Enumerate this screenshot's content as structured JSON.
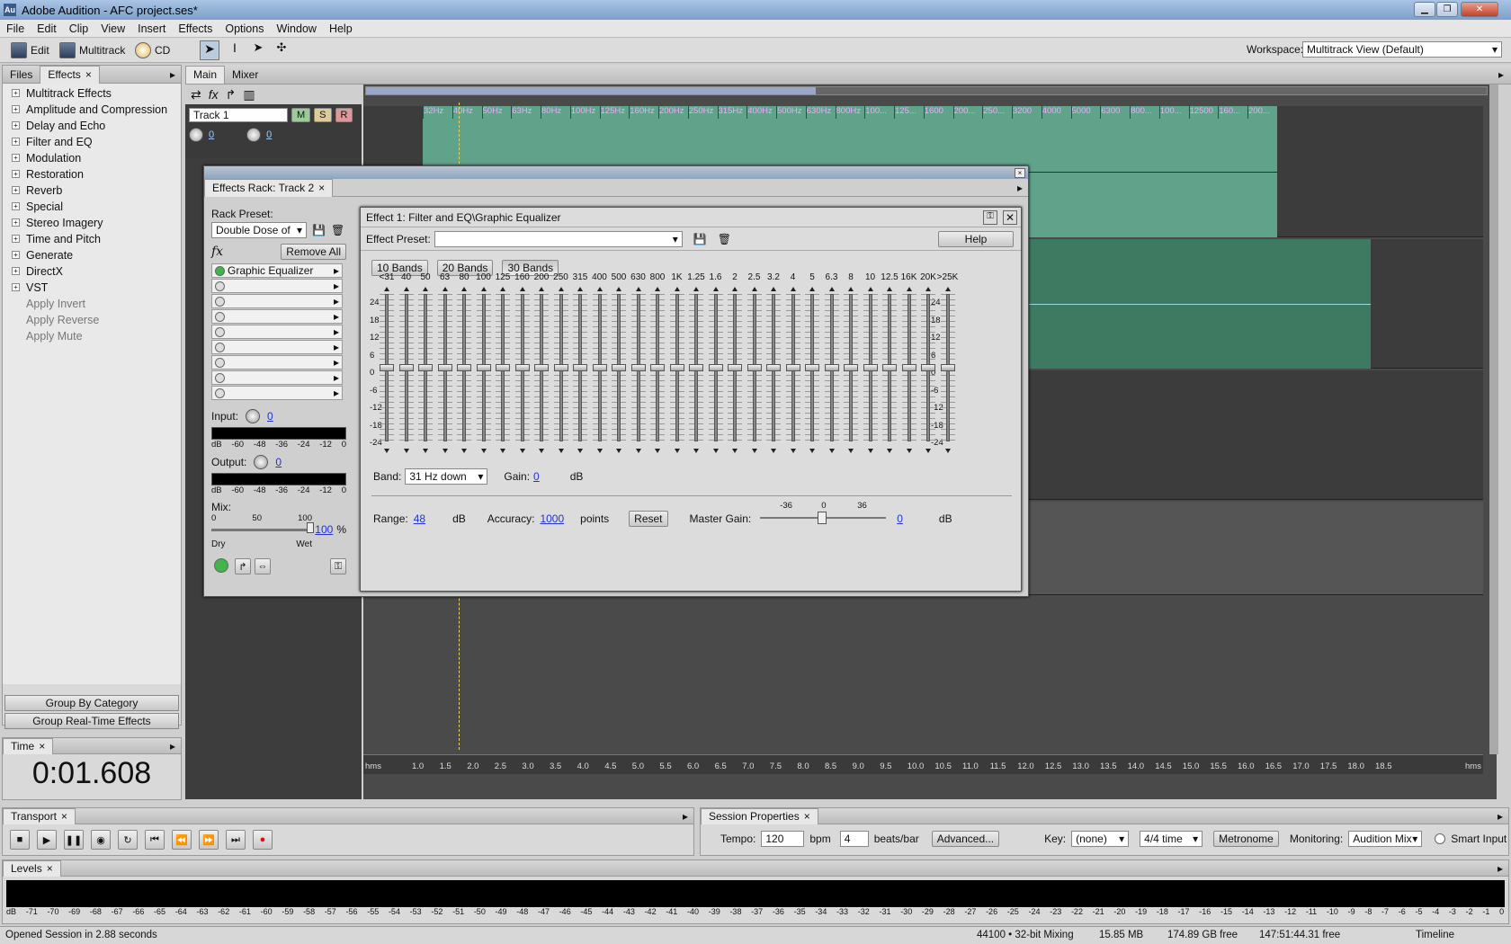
{
  "app": {
    "title": "Adobe Audition - AFC project.ses*",
    "icon": "Au"
  },
  "window_controls": [
    "minimize-icon",
    "restore-icon",
    "close-icon"
  ],
  "menu": [
    "File",
    "Edit",
    "Clip",
    "View",
    "Insert",
    "Effects",
    "Options",
    "Window",
    "Help"
  ],
  "toolbar": {
    "edit": "Edit",
    "multitrack": "Multitrack",
    "cd": "CD",
    "workspace_label": "Workspace:",
    "workspace_value": "Multitrack View (Default)"
  },
  "left_panel": {
    "tabs": [
      "Files",
      "Effects"
    ],
    "tree": [
      {
        "label": "Multitrack Effects",
        "expandable": true
      },
      {
        "label": "Amplitude and Compression",
        "expandable": true
      },
      {
        "label": "Delay and Echo",
        "expandable": true
      },
      {
        "label": "Filter and EQ",
        "expandable": true
      },
      {
        "label": "Modulation",
        "expandable": true
      },
      {
        "label": "Restoration",
        "expandable": true
      },
      {
        "label": "Reverb",
        "expandable": true
      },
      {
        "label": "Special",
        "expandable": true
      },
      {
        "label": "Stereo Imagery",
        "expandable": true
      },
      {
        "label": "Time and Pitch",
        "expandable": true
      },
      {
        "label": "Generate",
        "expandable": true
      },
      {
        "label": "DirectX",
        "expandable": true
      },
      {
        "label": "VST",
        "expandable": true
      },
      {
        "label": "Apply Invert",
        "expandable": false
      },
      {
        "label": "Apply Reverse",
        "expandable": false
      },
      {
        "label": "Apply Mute",
        "expandable": false
      }
    ],
    "group_by_category": "Group By Category",
    "group_realtime": "Group Real-Time Effects"
  },
  "time_panel": {
    "tab": "Time",
    "value": "0:01.608"
  },
  "main_tabs": [
    "Main",
    "Mixer"
  ],
  "track1": {
    "name": "Track 1",
    "m": "M",
    "s": "S",
    "r": "R",
    "vol": "0",
    "pan": "0"
  },
  "spectrum_labels": [
    "32Hz",
    "40Hz",
    "50Hz",
    "63Hz",
    "80Hz",
    "100Hz",
    "125Hz",
    "160Hz",
    "200Hz",
    "250Hz",
    "315Hz",
    "400Hz",
    "500Hz",
    "630Hz",
    "800Hz",
    "100...",
    "125...",
    "1600",
    "200...",
    "250...",
    "3200",
    "4000",
    "5000",
    "6300",
    "800...",
    "100...",
    "12500",
    "160...",
    "200..."
  ],
  "rack": {
    "title": "Effects Rack: Track 2",
    "preset_label": "Rack Preset:",
    "preset_value": "Double Dose of",
    "remove_all": "Remove All",
    "slots": [
      "Graphic Equalizer",
      "",
      "",
      "",
      "",
      "",
      "",
      "",
      ""
    ],
    "input_label": "Input:",
    "input_value": "0",
    "output_label": "Output:",
    "output_value": "0",
    "meter_scale": [
      "dB",
      "-60",
      "-48",
      "-36",
      "-24",
      "-12",
      "0"
    ],
    "mix_label": "Mix:",
    "mix_scale": [
      "0",
      "50",
      "100"
    ],
    "mix_value": "100",
    "mix_unit": "%",
    "dry": "Dry",
    "wet": "Wet"
  },
  "eq": {
    "title": "Effect 1: Filter and EQ\\Graphic Equalizer",
    "preset_label": "Effect Preset:",
    "help": "Help",
    "band_buttons": [
      "10 Bands",
      "20 Bands",
      "30 Bands"
    ],
    "freqs": [
      "<31",
      "40",
      "50",
      "63",
      "80",
      "100",
      "125",
      "160",
      "200",
      "250",
      "315",
      "400",
      "500",
      "630",
      "800",
      "1K",
      "1.25",
      "1.6",
      "2",
      "2.5",
      "3.2",
      "4",
      "5",
      "6.3",
      "8",
      "10",
      "12.5",
      "16K",
      "20K",
      ">25K"
    ],
    "db_scale": [
      "24",
      "18",
      "12",
      "6",
      "0",
      "-6",
      "-12",
      "-18",
      "-24"
    ],
    "gains": [
      0,
      0,
      0,
      0,
      0,
      0,
      0,
      0,
      0,
      0,
      0,
      0,
      0,
      0,
      0,
      0,
      0,
      0,
      0,
      0,
      0,
      0,
      0,
      0,
      0,
      0,
      0,
      0,
      0,
      0
    ],
    "band_label": "Band:",
    "band_value": "31 Hz down",
    "gain_label": "Gain:",
    "gain_value": "0",
    "gain_unit": "dB",
    "range_label": "Range:",
    "range_value": "48",
    "range_unit": "dB",
    "accuracy_label": "Accuracy:",
    "accuracy_value": "1000",
    "accuracy_unit": "points",
    "reset": "Reset",
    "master_label": "Master Gain:",
    "master_scale": [
      "-36",
      "0",
      "36"
    ],
    "master_value": "0",
    "master_unit": "dB"
  },
  "timeline": {
    "unit": "hms",
    "ticks": [
      "1.0",
      "1.5",
      "2.0",
      "2.5",
      "3.0",
      "3.5",
      "4.0",
      "4.5",
      "5.0",
      "5.5",
      "6.0",
      "6.5",
      "7.0",
      "7.5",
      "8.0",
      "8.5",
      "9.0",
      "9.5",
      "10.0",
      "10.5",
      "11.0",
      "11.5",
      "12.0",
      "12.5",
      "13.0",
      "13.5",
      "14.0",
      "14.5",
      "15.0",
      "15.5",
      "16.0",
      "16.5",
      "17.0",
      "17.5",
      "18.0",
      "18.5"
    ],
    "end_unit": "hms"
  },
  "transport": {
    "tab": "Transport"
  },
  "session": {
    "tab": "Session Properties",
    "tempo_label": "Tempo:",
    "tempo": "120",
    "bpm": "bpm",
    "beats": "4",
    "beats_label": "beats/bar",
    "advanced": "Advanced...",
    "key_label": "Key:",
    "key": "(none)",
    "time_sig": "4/4 time",
    "metronome": "Metronome",
    "monitoring_label": "Monitoring:",
    "monitoring": "Audition Mix",
    "smart_input": "Smart Input"
  },
  "levels": {
    "tab": "Levels",
    "scale": [
      "dB",
      "-71",
      "-70",
      "-69",
      "-68",
      "-67",
      "-66",
      "-65",
      "-64",
      "-63",
      "-62",
      "-61",
      "-60",
      "-59",
      "-58",
      "-57",
      "-56",
      "-55",
      "-54",
      "-53",
      "-52",
      "-51",
      "-50",
      "-49",
      "-48",
      "-47",
      "-46",
      "-45",
      "-44",
      "-43",
      "-42",
      "-41",
      "-40",
      "-39",
      "-38",
      "-37",
      "-36",
      "-35",
      "-34",
      "-33",
      "-32",
      "-31",
      "-30",
      "-29",
      "-28",
      "-27",
      "-26",
      "-25",
      "-24",
      "-23",
      "-22",
      "-21",
      "-20",
      "-19",
      "-18",
      "-17",
      "-16",
      "-15",
      "-14",
      "-13",
      "-12",
      "-11",
      "-10",
      "-9",
      "-8",
      "-7",
      "-6",
      "-5",
      "-4",
      "-3",
      "-2",
      "-1",
      "0"
    ]
  },
  "status": {
    "left": "Opened Session in 2.88 seconds",
    "rate": "44100 • 32-bit Mixing",
    "mem": "15.85 MB",
    "disk": "174.89 GB free",
    "time_free": "147:51:44.31 free",
    "timeline": "Timeline"
  }
}
